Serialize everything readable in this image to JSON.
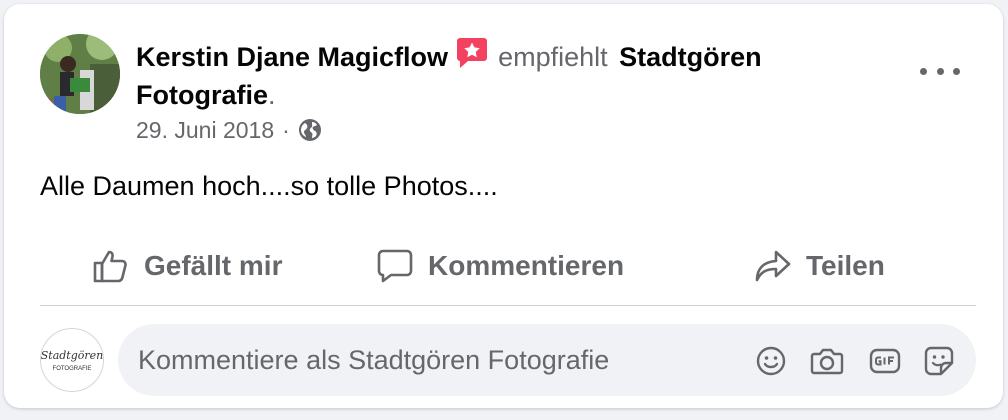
{
  "post": {
    "author_name": "Kerstin Djane Magicflow",
    "verb": "empfiehlt",
    "page_name": "Stadtgören Fotografie",
    "period": ".",
    "date": "29. Juni 2018",
    "separator": "·",
    "privacy_icon": "globe-icon",
    "recommend_icon": "star-badge-icon",
    "text": "Alle Daumen hoch....so tolle Photos...."
  },
  "actions": {
    "like_label": "Gefällt mir",
    "comment_label": "Kommentieren",
    "share_label": "Teilen"
  },
  "comment": {
    "placeholder": "Kommentiere als Stadtgören Fotografie",
    "avatar_text_line1": "Stadtgören",
    "avatar_text_line2": "FOTOGRAFIE",
    "tools": [
      "emoji-icon",
      "camera-icon",
      "gif-icon",
      "sticker-icon"
    ]
  },
  "colors": {
    "badge": "#f3425f",
    "secondary_text": "#65676b",
    "primary_text": "#050505",
    "background": "#f0f2f5"
  }
}
